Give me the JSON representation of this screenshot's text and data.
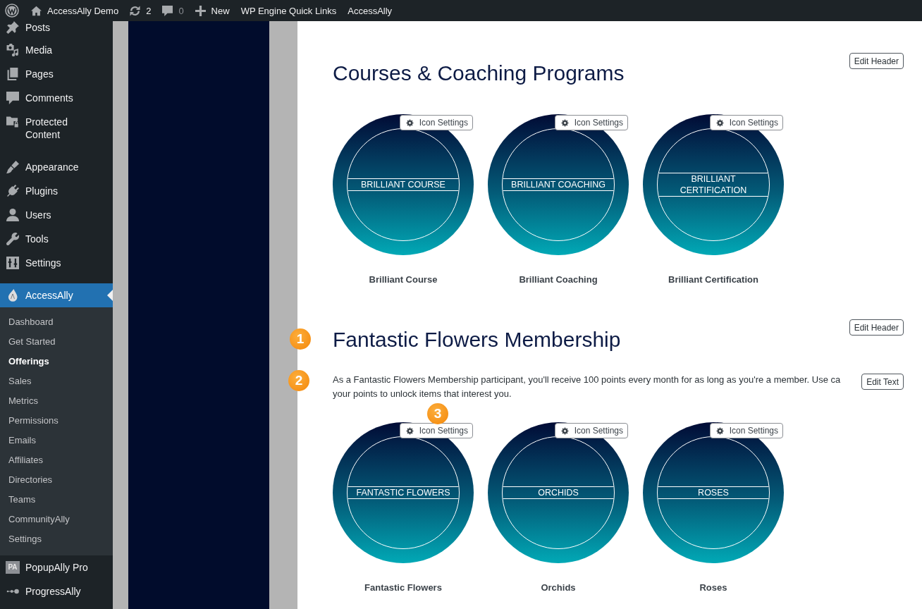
{
  "admin_bar": {
    "items": [
      {
        "kind": "logo"
      },
      {
        "kind": "site",
        "label": "AccessAlly Demo"
      },
      {
        "kind": "updates",
        "label": "2"
      },
      {
        "kind": "comments",
        "label": "0"
      },
      {
        "kind": "new",
        "label": "New"
      },
      {
        "kind": "link",
        "label": "WP Engine Quick Links"
      },
      {
        "kind": "link",
        "label": "AccessAlly"
      }
    ]
  },
  "sidebar": {
    "groups": [
      {
        "items": [
          {
            "kind": "pin",
            "label": "Posts",
            "selected": false
          },
          {
            "kind": "media",
            "label": "Media",
            "selected": false
          },
          {
            "kind": "pages",
            "label": "Pages",
            "selected": false
          },
          {
            "kind": "comment",
            "label": "Comments",
            "selected": false
          },
          {
            "kind": "folder",
            "label": "Protected Content",
            "selected": false
          }
        ]
      },
      {
        "items": [
          {
            "kind": "brush",
            "label": "Appearance",
            "selected": false
          },
          {
            "kind": "plug",
            "label": "Plugins",
            "selected": false
          },
          {
            "kind": "user",
            "label": "Users",
            "selected": false
          },
          {
            "kind": "wrench",
            "label": "Tools",
            "selected": false
          },
          {
            "kind": "sliders",
            "label": "Settings",
            "selected": false
          }
        ]
      },
      {
        "items": [
          {
            "kind": "drop",
            "label": "AccessAlly",
            "selected": true,
            "children": [
              {
                "label": "Dashboard",
                "selected": false
              },
              {
                "label": "Get Started",
                "selected": false
              },
              {
                "label": "Offerings",
                "selected": true
              },
              {
                "label": "Sales",
                "selected": false
              },
              {
                "label": "Metrics",
                "selected": false
              },
              {
                "label": "Permissions",
                "selected": false
              },
              {
                "label": "Emails",
                "selected": false
              },
              {
                "label": "Affiliates",
                "selected": false
              },
              {
                "label": "Directories",
                "selected": false
              },
              {
                "label": "Teams",
                "selected": false
              },
              {
                "label": "CommunityAlly",
                "selected": false
              },
              {
                "label": "Settings",
                "selected": false
              }
            ]
          },
          {
            "kind": "tile",
            "logo_text": "PA",
            "label": "PopupAlly Pro",
            "selected": false
          },
          {
            "kind": "dots",
            "label": "ProgressAlly",
            "selected": false
          }
        ]
      }
    ]
  },
  "sections": [
    {
      "heading": "Courses & Coaching Programs",
      "header_button": "Edit Header",
      "offerings": [
        {
          "emblem_text": "BRILLIANT COURSE",
          "name": "Brilliant Course",
          "settings_button": "Icon Settings"
        },
        {
          "emblem_text": "BRILLIANT COACHING",
          "name": "Brilliant Coaching",
          "settings_button": "Icon Settings"
        },
        {
          "emblem_text": "BRILLIANT CERTIFICATION",
          "name": "Brilliant Certification",
          "settings_button": "Icon Settings"
        }
      ]
    },
    {
      "heading": "Fantastic Flowers Membership",
      "heading_callout": "1",
      "header_button": "Edit Header",
      "description": "As a Fantastic Flowers Membership participant, you'll receive 100 points every month for as long as you're a member. Use ca\nyour points to unlock items that interest you.",
      "description_callout": "2",
      "text_button": "Edit Text",
      "offerings": [
        {
          "emblem_text": "FANTASTIC FLOWERS",
          "name": "Fantastic Flowers",
          "settings_button": "Icon Settings",
          "callout": "3"
        },
        {
          "emblem_text": "ORCHIDS",
          "name": "Orchids",
          "settings_button": "Icon Settings"
        },
        {
          "emblem_text": "ROSES",
          "name": "Roses",
          "settings_button": "Icon Settings"
        }
      ]
    }
  ]
}
